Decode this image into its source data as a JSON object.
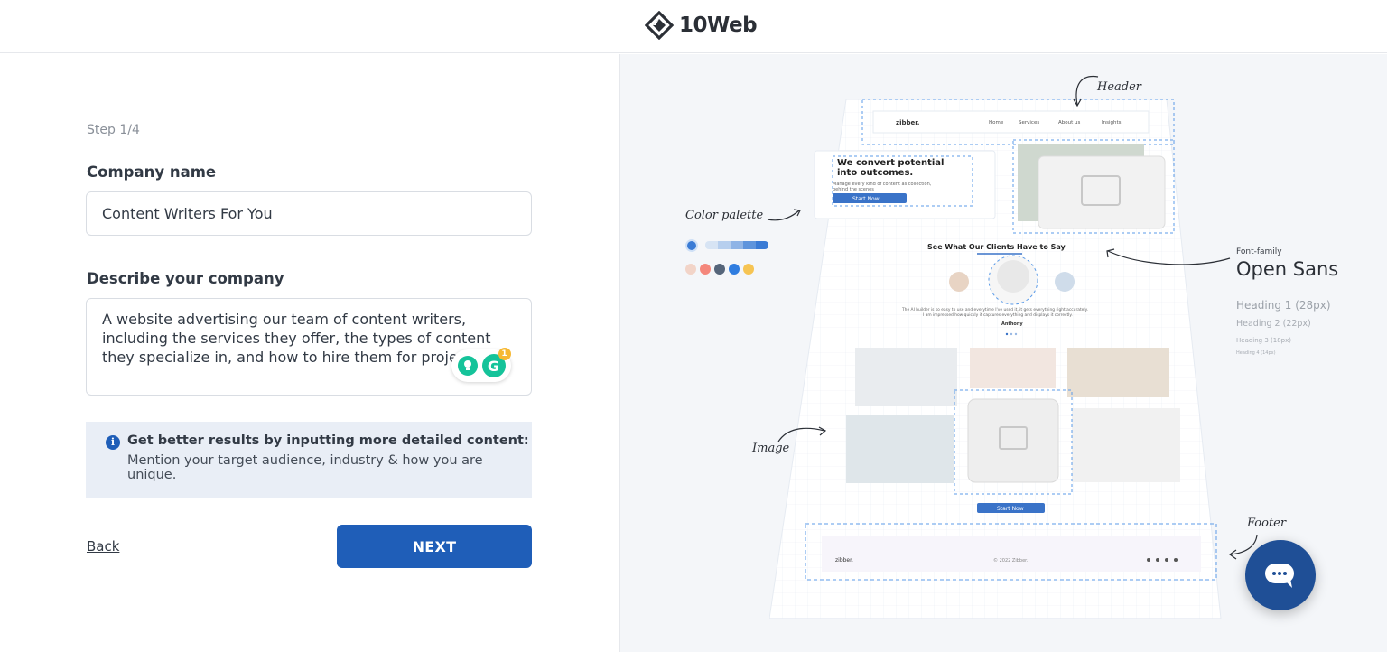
{
  "header": {
    "brand": "10Web"
  },
  "form": {
    "step": "Step 1/4",
    "company_label": "Company name",
    "company_value": "Content Writers For You",
    "describe_label": "Describe your company",
    "describe_value": "A website advertising our team of content writers, including the services they offer, the types of content they specialize in, and how to hire them for projects.",
    "grammarly_count": "1",
    "tip_title": "Get better results by inputting more detailed content:",
    "tip_body": "Mention your target audience, industry & how you are unique.",
    "back_label": "Back",
    "next_label": "NEXT"
  },
  "preview": {
    "annotations": {
      "header": "Header",
      "color_palette": "Color palette",
      "image": "Image",
      "footer": "Footer"
    },
    "font_family_label": "Font-family",
    "font_family_name": "Open Sans",
    "headings": [
      "Heading 1 (28px)",
      "Heading 2 (22px)",
      "Heading 3 (18px)",
      "Heading 4 (14px)"
    ],
    "mock": {
      "logo": "zibber.",
      "nav": [
        "Home",
        "Services",
        "About us",
        "Insights"
      ],
      "hero_title_1": "We convert potential",
      "hero_title_2": "into outcomes.",
      "hero_sub_1": "Manage every kind of content as collection,",
      "hero_sub_2": "behind the scenes",
      "hero_cta": "Start Now",
      "testimonials_title": "See What Our Clients Have to Say",
      "quote_1": "The AI builder is so easy to use and everytime I've used it, it gets everything right accurately.",
      "quote_2": "I am impressed how quickly it captures everything and displays it correctly.",
      "quote_author": "Anthony",
      "cta2": "Start Now",
      "footer_logo": "zibber.",
      "footer_copy": "© 2022 Zibber."
    },
    "palette_colors": [
      "#f2d4c8",
      "#f4877c",
      "#55657a",
      "#2f7de0",
      "#f6c453"
    ],
    "palette_shades": [
      "#d7e4f4",
      "#b7cfee",
      "#8fb4e6",
      "#5e94dc",
      "#3a7bd5"
    ]
  },
  "colors": {
    "primary": "#1f5eb8",
    "tip_bg": "#e9eef6",
    "chat": "#1f4f96"
  }
}
